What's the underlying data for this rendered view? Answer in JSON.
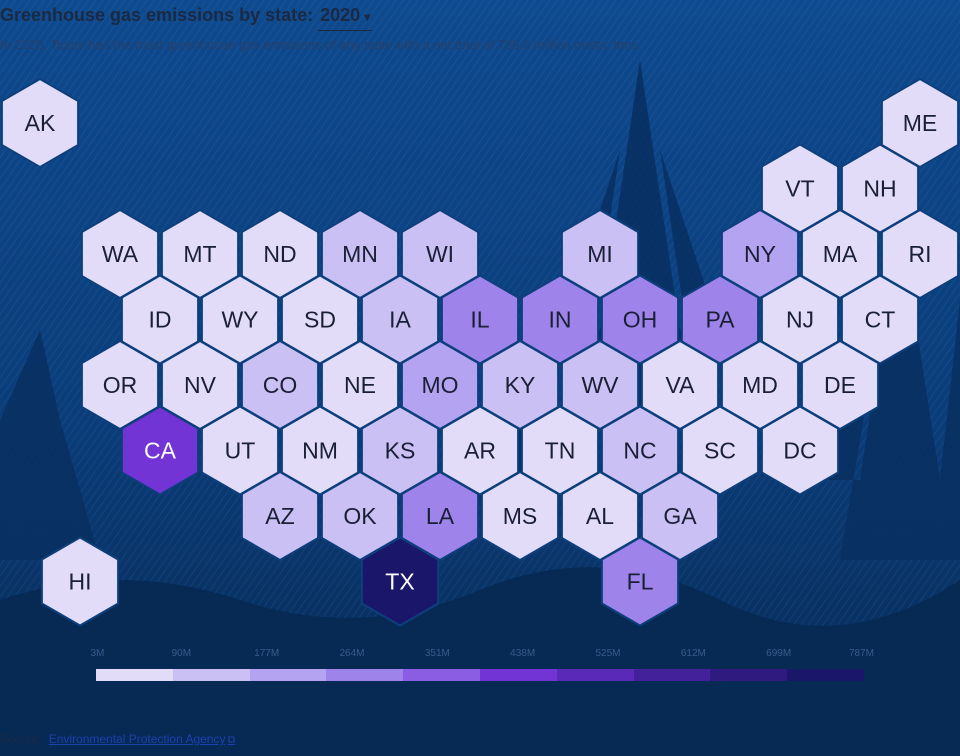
{
  "header": {
    "title_prefix": "Greenhouse gas emissions by state:",
    "year": "2020",
    "subtitle": "In 2020, Texas had the most greenhouse gas emissions of any state with a net total of 786.6 million metric tons."
  },
  "colors": {
    "background": "#0b3b78",
    "hex_border": "#0d3f7d",
    "text_dark": "#1a1f36",
    "text_light": "#ffffff",
    "scale": [
      "#e2dcf8",
      "#cac0f4",
      "#b4a3f1",
      "#9e84ea",
      "#8a5de3",
      "#7234d5",
      "#5a29b8",
      "#43219a",
      "#2f1a80",
      "#1a166a"
    ]
  },
  "legend": {
    "ticks": [
      "3M",
      "90M",
      "177M",
      "264M",
      "351M",
      "438M",
      "525M",
      "612M",
      "699M",
      "787M"
    ]
  },
  "states": [
    {
      "abbr": "AK",
      "col": 0,
      "row": 0,
      "level": 0
    },
    {
      "abbr": "ME",
      "col": 11,
      "row": 0,
      "level": 0
    },
    {
      "abbr": "VT",
      "col": 9.5,
      "row": 1,
      "level": 0
    },
    {
      "abbr": "NH",
      "col": 10.5,
      "row": 1,
      "level": 0
    },
    {
      "abbr": "WA",
      "col": 1,
      "row": 2,
      "level": 0
    },
    {
      "abbr": "MT",
      "col": 2,
      "row": 2,
      "level": 0
    },
    {
      "abbr": "ND",
      "col": 3,
      "row": 2,
      "level": 0
    },
    {
      "abbr": "MN",
      "col": 4,
      "row": 2,
      "level": 1
    },
    {
      "abbr": "WI",
      "col": 5,
      "row": 2,
      "level": 1
    },
    {
      "abbr": "MI",
      "col": 7,
      "row": 2,
      "level": 1
    },
    {
      "abbr": "NY",
      "col": 9,
      "row": 2,
      "level": 2
    },
    {
      "abbr": "MA",
      "col": 10,
      "row": 2,
      "level": 0
    },
    {
      "abbr": "RI",
      "col": 11,
      "row": 2,
      "level": 0
    },
    {
      "abbr": "ID",
      "col": 1.5,
      "row": 3,
      "level": 0
    },
    {
      "abbr": "WY",
      "col": 2.5,
      "row": 3,
      "level": 0
    },
    {
      "abbr": "SD",
      "col": 3.5,
      "row": 3,
      "level": 0
    },
    {
      "abbr": "IA",
      "col": 4.5,
      "row": 3,
      "level": 1
    },
    {
      "abbr": "IL",
      "col": 5.5,
      "row": 3,
      "level": 3
    },
    {
      "abbr": "IN",
      "col": 6.5,
      "row": 3,
      "level": 3
    },
    {
      "abbr": "OH",
      "col": 7.5,
      "row": 3,
      "level": 3
    },
    {
      "abbr": "PA",
      "col": 8.5,
      "row": 3,
      "level": 3
    },
    {
      "abbr": "NJ",
      "col": 9.5,
      "row": 3,
      "level": 0
    },
    {
      "abbr": "CT",
      "col": 10.5,
      "row": 3,
      "level": 0
    },
    {
      "abbr": "OR",
      "col": 1,
      "row": 4,
      "level": 0
    },
    {
      "abbr": "NV",
      "col": 2,
      "row": 4,
      "level": 0
    },
    {
      "abbr": "CO",
      "col": 3,
      "row": 4,
      "level": 1
    },
    {
      "abbr": "NE",
      "col": 4,
      "row": 4,
      "level": 0
    },
    {
      "abbr": "MO",
      "col": 5,
      "row": 4,
      "level": 2
    },
    {
      "abbr": "KY",
      "col": 6,
      "row": 4,
      "level": 1
    },
    {
      "abbr": "WV",
      "col": 7,
      "row": 4,
      "level": 1
    },
    {
      "abbr": "VA",
      "col": 8,
      "row": 4,
      "level": 0
    },
    {
      "abbr": "MD",
      "col": 9,
      "row": 4,
      "level": 0
    },
    {
      "abbr": "DE",
      "col": 10,
      "row": 4,
      "level": 0
    },
    {
      "abbr": "CA",
      "col": 1.5,
      "row": 5,
      "level": 5
    },
    {
      "abbr": "UT",
      "col": 2.5,
      "row": 5,
      "level": 0
    },
    {
      "abbr": "NM",
      "col": 3.5,
      "row": 5,
      "level": 0
    },
    {
      "abbr": "KS",
      "col": 4.5,
      "row": 5,
      "level": 1
    },
    {
      "abbr": "AR",
      "col": 5.5,
      "row": 5,
      "level": 0
    },
    {
      "abbr": "TN",
      "col": 6.5,
      "row": 5,
      "level": 0
    },
    {
      "abbr": "NC",
      "col": 7.5,
      "row": 5,
      "level": 1
    },
    {
      "abbr": "SC",
      "col": 8.5,
      "row": 5,
      "level": 0
    },
    {
      "abbr": "DC",
      "col": 9.5,
      "row": 5,
      "level": 0
    },
    {
      "abbr": "AZ",
      "col": 3,
      "row": 6,
      "level": 1
    },
    {
      "abbr": "OK",
      "col": 4,
      "row": 6,
      "level": 1
    },
    {
      "abbr": "LA",
      "col": 5,
      "row": 6,
      "level": 3
    },
    {
      "abbr": "MS",
      "col": 6,
      "row": 6,
      "level": 0
    },
    {
      "abbr": "AL",
      "col": 7,
      "row": 6,
      "level": 0
    },
    {
      "abbr": "GA",
      "col": 8,
      "row": 6,
      "level": 1
    },
    {
      "abbr": "HI",
      "col": 0.5,
      "row": 7,
      "level": 0
    },
    {
      "abbr": "TX",
      "col": 4.5,
      "row": 7,
      "level": 9
    },
    {
      "abbr": "FL",
      "col": 7.5,
      "row": 7,
      "level": 3
    }
  ],
  "source": {
    "label": "Source:",
    "link_text": "Environmental Protection Agency",
    "link_icon": "external-link-icon"
  }
}
